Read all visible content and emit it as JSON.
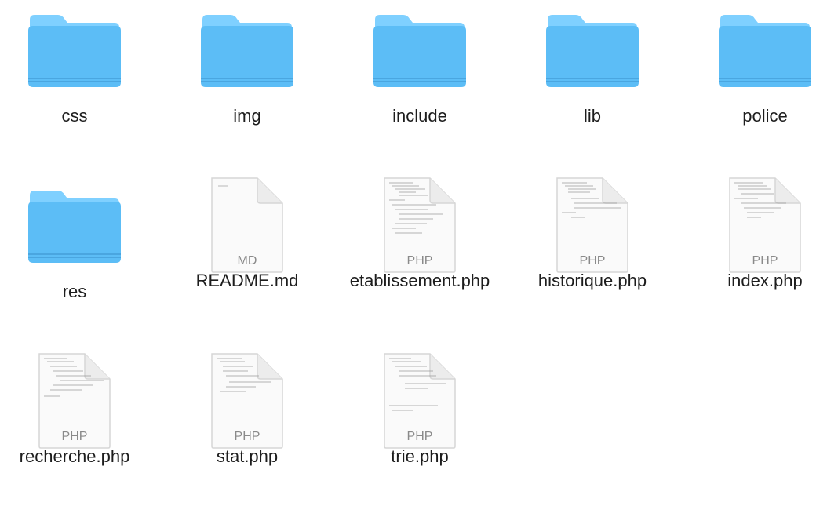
{
  "folders": [
    {
      "name": "css",
      "icon": "folder-icon"
    },
    {
      "name": "img",
      "icon": "folder-icon"
    },
    {
      "name": "include",
      "icon": "folder-icon"
    },
    {
      "name": "lib",
      "icon": "folder-icon"
    },
    {
      "name": "police",
      "icon": "folder-icon"
    },
    {
      "name": "res",
      "icon": "folder-icon"
    }
  ],
  "files": [
    {
      "name": "README.md",
      "ext": "MD",
      "icon": "markdown-file-icon"
    },
    {
      "name": "etablissement.php",
      "ext": "PHP",
      "icon": "php-file-icon"
    },
    {
      "name": "historique.php",
      "ext": "PHP",
      "icon": "php-file-icon"
    },
    {
      "name": "index.php",
      "ext": "PHP",
      "icon": "php-file-icon"
    },
    {
      "name": "recherche.php",
      "ext": "PHP",
      "icon": "php-file-icon"
    },
    {
      "name": "stat.php",
      "ext": "PHP",
      "icon": "php-file-icon"
    },
    {
      "name": "trie.php",
      "ext": "PHP",
      "icon": "php-file-icon"
    }
  ],
  "colors": {
    "folder_light": "#7fd0ff",
    "folder_main": "#5cbdf6",
    "folder_edge": "#4aa6e0",
    "doc_fill": "#fafafa",
    "doc_border": "#d6d6d6"
  }
}
